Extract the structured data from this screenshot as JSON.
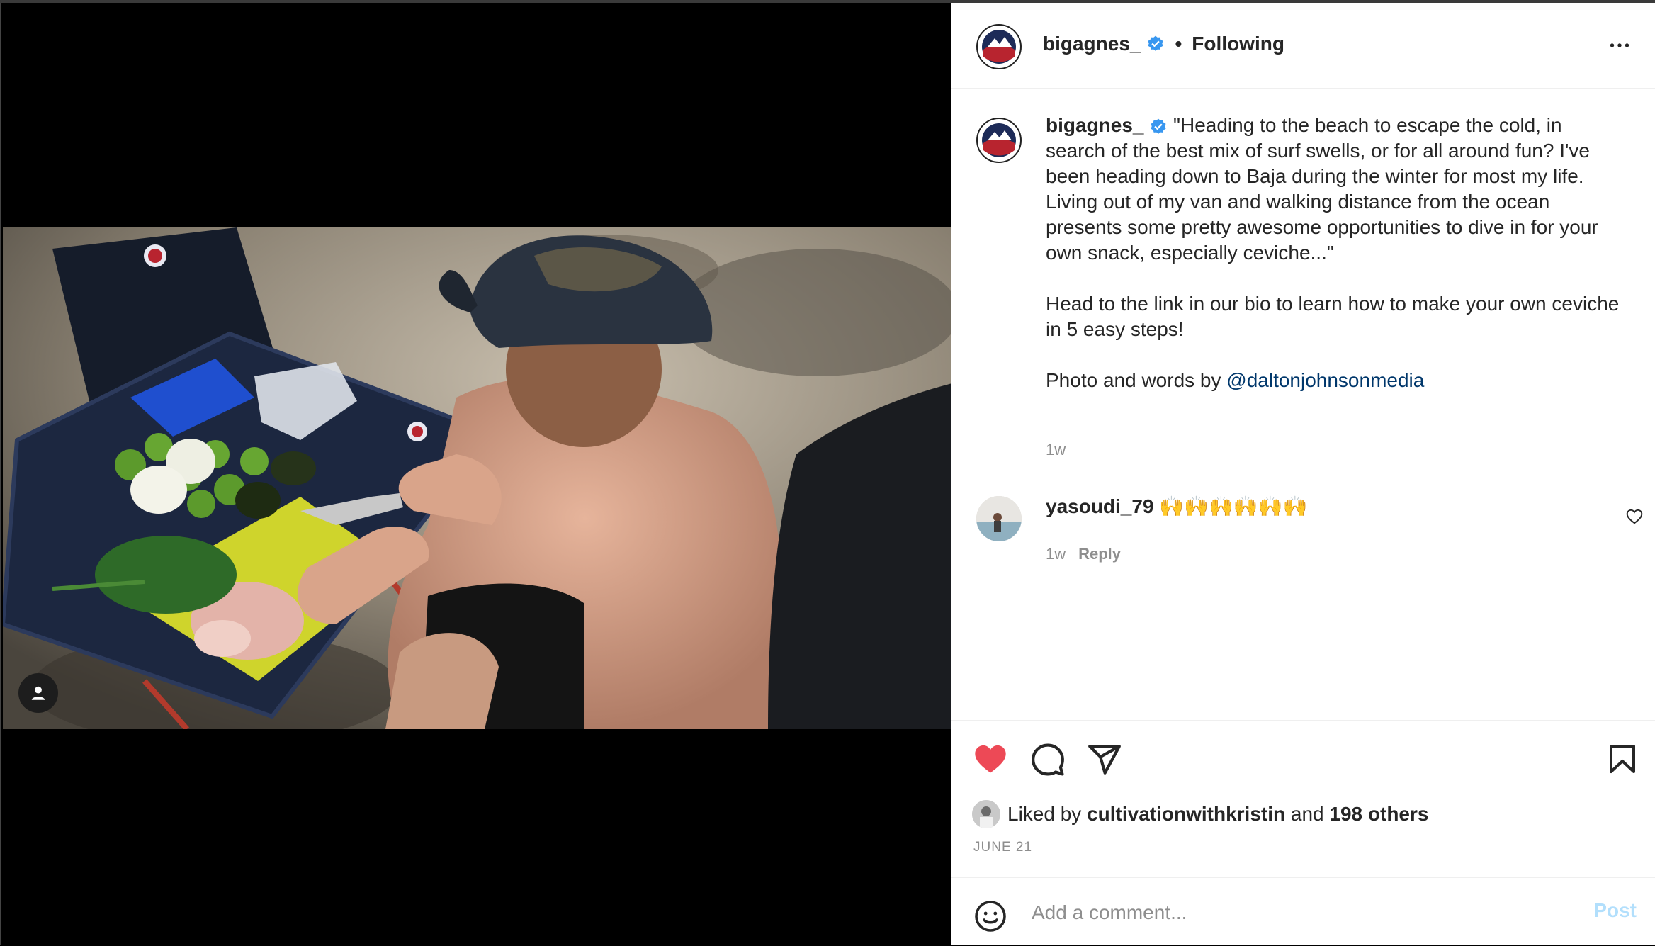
{
  "post": {
    "username": "bigagnes_",
    "follow_status": "Following",
    "caption_paragraphs": [
      "\"Heading to the beach to escape the cold, in search of the best mix of surf swells, or for all around fun? I've been heading down to Baja during the winter for most my life. Living out of my van and walking distance from the ocean presents some pretty awesome opportunities to dive in for your own snack, especially ceviche...\"",
      "Head to the link in our bio to learn how to make your own ceviche in 5 easy steps!"
    ],
    "credit_prefix": "Photo and words by ",
    "credit_mention": "@daltonjohnsonmedia",
    "caption_time": "1w",
    "date": "JUNE 21"
  },
  "comments": [
    {
      "username": "yasoudi_79",
      "text": "🙌🙌🙌🙌🙌🙌",
      "time": "1w",
      "reply_label": "Reply"
    }
  ],
  "likes": {
    "prefix": "Liked by ",
    "user": "cultivationwithkristin",
    "middle": " and ",
    "others": "198 others"
  },
  "add_comment": {
    "placeholder": "Add a comment...",
    "post_label": "Post"
  },
  "icons": {
    "like": "heart-filled-icon",
    "comment": "comment-bubble-icon",
    "share": "paper-plane-icon",
    "save": "bookmark-icon",
    "more": "more-options-icon",
    "tagged_users": "user-tag-icon",
    "emoji": "emoji-icon"
  },
  "colors": {
    "like_red": "#ed4956",
    "verified_blue": "#3897f0",
    "mention_blue": "#00376b",
    "post_button_disabled": "#b2dffc"
  }
}
